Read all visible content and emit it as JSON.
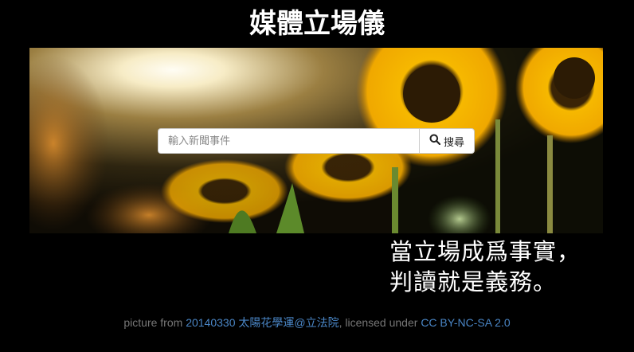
{
  "header": {
    "title": "媒體立場儀"
  },
  "search": {
    "placeholder": "輸入新聞事件",
    "value": "",
    "button_label": "搜尋",
    "button_icon": "search-icon"
  },
  "tagline": {
    "line1": "當立場成爲事實，",
    "line2": "判讀就是義務。"
  },
  "footer": {
    "prefix": "picture from ",
    "photo_link_label": "20140330 太陽花學運@立法院",
    "middle": ", licensed under ",
    "license_link_label": "CC BY-NC-SA 2.0"
  },
  "colors": {
    "background": "#000000",
    "link": "#4a86c6",
    "footer_text": "#777777",
    "sunflower": "#f0b400"
  }
}
